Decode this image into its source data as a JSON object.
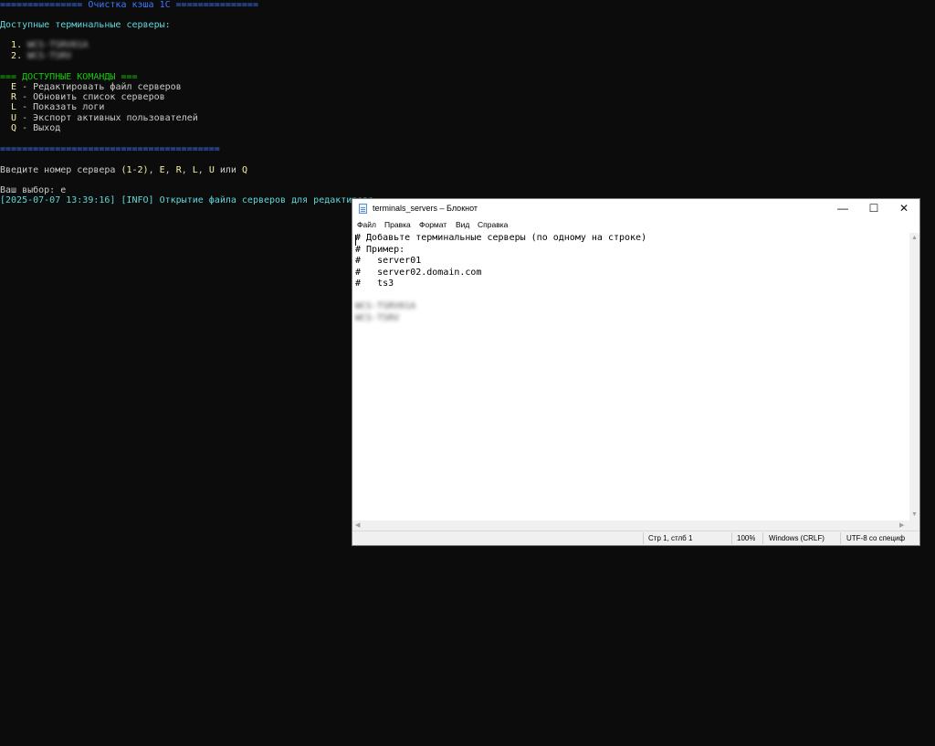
{
  "console": {
    "header_line": "=============== Очистка кэша 1С ===============",
    "servers_title": "Доступные терминальные серверы:",
    "servers": [
      {
        "num": "1.",
        "name": "WCS-TSRV01A"
      },
      {
        "num": "2.",
        "name": "WCS-TSRV"
      }
    ],
    "commands_title": "=== ДОСТУПНЫЕ КОМАНДЫ ===",
    "commands": [
      {
        "key": "E",
        "desc": " - Редактировать файл серверов"
      },
      {
        "key": "R",
        "desc": " - Обновить список серверов"
      },
      {
        "key": "L",
        "desc": " - Показать логи"
      },
      {
        "key": "U",
        "desc": " - Экспорт активных пользователей"
      },
      {
        "key": "Q",
        "desc": " - Выход"
      }
    ],
    "divider": "========================================",
    "prompt_pre": "Введите номер сервера ",
    "prompt_range": "(1-2)",
    "prompt_sep1": ", ",
    "prompt_e": "E",
    "prompt_sep2": ", ",
    "prompt_r": "R",
    "prompt_sep3": ", ",
    "prompt_l": "L",
    "prompt_sep4": ", ",
    "prompt_u": "U",
    "prompt_or": " или ",
    "prompt_q": "Q",
    "choice_label": "Ваш выбор: ",
    "choice_value": "e",
    "log_line": "[2025-07-07 13:39:16] [INFO] Открытие файла серверов для редактирова"
  },
  "notepad": {
    "title": "terminals_servers – Блокнот",
    "menu": [
      "Файл",
      "Правка",
      "Формат",
      "Вид",
      "Справка"
    ],
    "lines": [
      "# Добавьте терминальные серверы (по одному на строке)",
      "# Пример:",
      "#   server01",
      "#   server02.domain.com",
      "#   ts3",
      "",
      "WCS-TSRV01A",
      "WCS-TSRV"
    ],
    "status": {
      "position": "Стр 1, стлб 1",
      "zoom": "100%",
      "line_ending": "Windows (CRLF)",
      "encoding": "UTF-8 со специф"
    },
    "controls": {
      "minimize": "—",
      "maximize": "☐",
      "close": "✕"
    }
  },
  "colors": {
    "console_bg": "#0c0c0c",
    "blue": "#3b78ff",
    "yellow": "#f9f1a5",
    "cyan": "#61d6d6",
    "green": "#16c60c",
    "gray": "#cccccc"
  }
}
